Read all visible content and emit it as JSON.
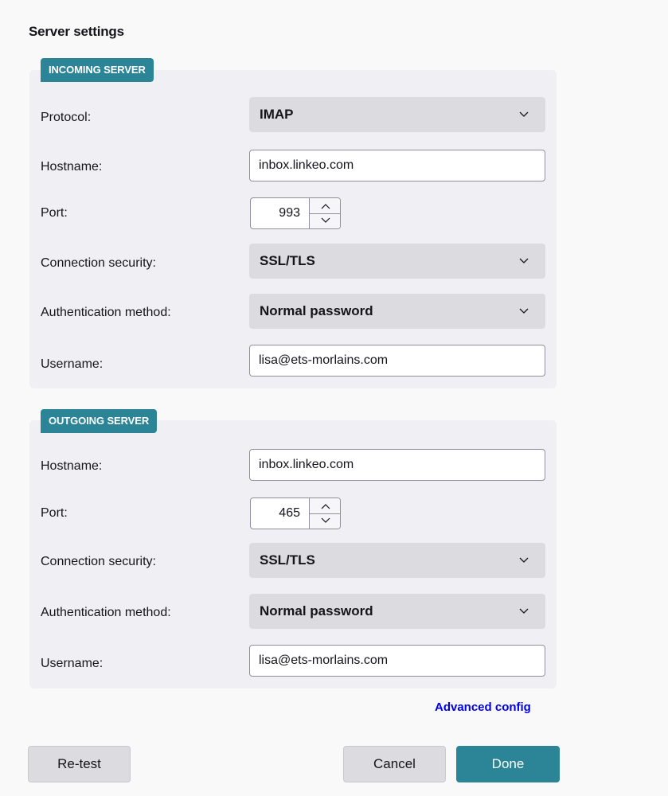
{
  "page": {
    "title": "Server settings"
  },
  "incoming": {
    "badge": "INCOMING SERVER",
    "protocol_label": "Protocol:",
    "protocol_value": "IMAP",
    "hostname_label": "Hostname:",
    "hostname_value": "inbox.linkeo.com",
    "port_label": "Port:",
    "port_value": "993",
    "security_label": "Connection security:",
    "security_value": "SSL/TLS",
    "auth_label": "Authentication method:",
    "auth_value": "Normal password",
    "username_label": "Username:",
    "username_value": "lisa@ets-morlains.com"
  },
  "outgoing": {
    "badge": "OUTGOING SERVER",
    "hostname_label": "Hostname:",
    "hostname_value": "inbox.linkeo.com",
    "port_label": "Port:",
    "port_value": "465",
    "security_label": "Connection security:",
    "security_value": "SSL/TLS",
    "auth_label": "Authentication method:",
    "auth_value": "Normal password",
    "username_label": "Username:",
    "username_value": "lisa@ets-morlains.com"
  },
  "links": {
    "advanced": "Advanced config"
  },
  "buttons": {
    "retest": "Re-test",
    "cancel": "Cancel",
    "done": "Done"
  },
  "colors": {
    "accent": "#2b8596",
    "link": "#0000ee",
    "section_bg": "#f0f0f4",
    "select_bg": "#dcdce0"
  },
  "icons": {
    "dropdown": "chevron-down-icon",
    "spin_up": "chevron-up-icon",
    "spin_down": "chevron-down-icon"
  }
}
